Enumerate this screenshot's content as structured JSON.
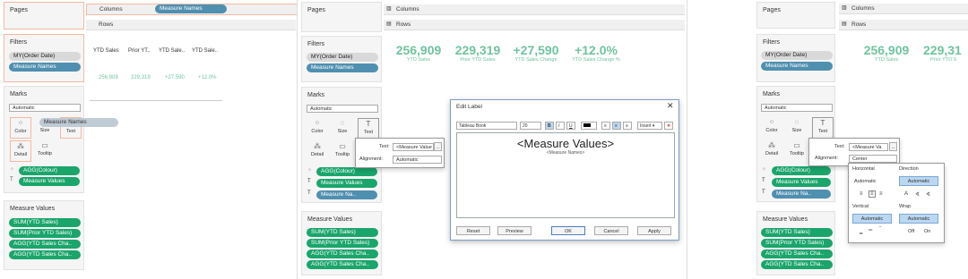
{
  "panel1": {
    "pages": "Pages",
    "columns_label": "Columns",
    "columns_pill": "Measure Names",
    "rows_label": "Rows",
    "filters": "Filters",
    "filter_pills": [
      "MY(Order Date)",
      "Measure Names"
    ],
    "marks": "Marks",
    "mark_type": "Automatic",
    "mark_buttons": [
      "Color",
      "Size",
      "Text",
      "Detail",
      "Tooltip"
    ],
    "drag_pill": "Measure Names",
    "mark_pills": [
      "AGG(Colour)",
      "Measure Values"
    ],
    "measure_values": "Measure Values",
    "measure_pills": [
      "SUM(YTD Sales)",
      "SUM(Prior YTD Sales)",
      "AGG(YTD Sales Cha..",
      "AGG(YTD Sales Cha.."
    ],
    "table_headers": [
      "YTD Sales",
      "Prior YT..",
      "YTD Sale..",
      "YTD Sale.."
    ],
    "table_values": [
      "256,909",
      "229,319",
      "+27,590",
      "+12.0%"
    ]
  },
  "panel2": {
    "pages": "Pages",
    "columns_label": "Columns",
    "rows_label": "Rows",
    "filters": "Filters",
    "filter_pills": [
      "MY(Order Date)",
      "Measure Names"
    ],
    "marks": "Marks",
    "mark_type": "Automatic",
    "mark_buttons": [
      "Color",
      "Size",
      "Text",
      "Detail",
      "Tooltip"
    ],
    "mark_pills": [
      "AGG(Colour)",
      "Measure Values",
      "Measure Na.."
    ],
    "measure_values": "Measure Values",
    "measure_pills": [
      "SUM(YTD Sales)",
      "SUM(Prior YTD Sales)",
      "AGG(YTD Sales Cha..",
      "AGG(YTD Sales Cha.."
    ],
    "kpi_values": [
      "256,909",
      "229,319",
      "+27,590",
      "+12.0%"
    ],
    "kpi_labels": [
      "YTD Sales",
      "Prior YTD Sales",
      "YTD Sales Change",
      "YTD Sales Change %"
    ],
    "text_label": "Text:",
    "text_value": "<Measure Value",
    "ellipsis": "...",
    "alignment_label": "Alignment:",
    "alignment_value": "Automatic",
    "dialog": {
      "title": "Edit Label",
      "font": "Tableau Book",
      "size": "20",
      "bold": "B",
      "italic": "I",
      "underline": "U",
      "insert": "Insert",
      "big_text": "<Measure Values>",
      "small_text": "<Measure Names>",
      "reset": "Reset",
      "preview": "Preview",
      "ok": "OK",
      "cancel": "Cancel",
      "apply": "Apply"
    }
  },
  "panel3": {
    "pages": "Pages",
    "columns_label": "Columns",
    "rows_label": "Rows",
    "filters": "Filters",
    "filter_pills": [
      "MY(Order Date)",
      "Measure Names"
    ],
    "marks": "Marks",
    "mark_type": "Automatic",
    "mark_buttons": [
      "Color",
      "Size",
      "Text",
      "Detail",
      "Tooltip"
    ],
    "mark_pills": [
      "AGG(Colour)",
      "Measure Values",
      "Measure Na.."
    ],
    "measure_values": "Measure Values",
    "measure_pills": [
      "SUM(YTD Sales)",
      "SUM(Prior YTD Sales)",
      "AGG(YTD Sales Cha..",
      "AGG(YTD Sales Cha.."
    ],
    "kpi_values": [
      "256,909",
      "229,31"
    ],
    "kpi_labels": [
      "YTD Sales",
      "Prior YTD S"
    ],
    "text_label": "Text:",
    "text_value": "<Measure Va",
    "ellipsis": "...",
    "alignment_label": "Alignment:",
    "alignment_value": "Center",
    "popup": {
      "horizontal": "Horizontal",
      "direction": "Direction",
      "automatic": "Automatic",
      "vertical": "Vertical",
      "wrap": "Wrap",
      "off": "Off",
      "on": "On",
      "dir_a": "A"
    }
  }
}
